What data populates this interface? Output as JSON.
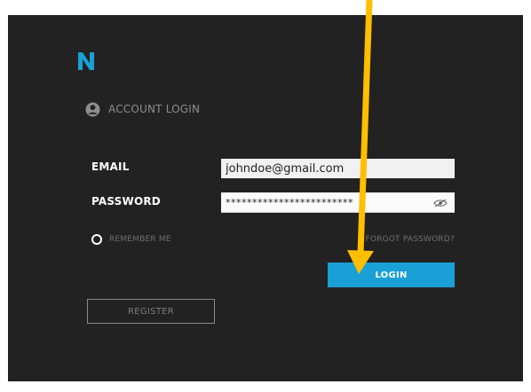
{
  "brand": {
    "logo_icon": "n-logo-icon",
    "accent_color": "#1aa0d7"
  },
  "header": {
    "icon": "user-icon",
    "title": "ACCOUNT LOGIN"
  },
  "form": {
    "email_label": "EMAIL",
    "email_value": "johndoe@gmail.com",
    "password_label": "PASSWORD",
    "password_value": "************************",
    "password_toggle_icon": "eye-icon",
    "remember_label": "REMEMBER ME",
    "forgot_label": "FORGOT PASSWORD?",
    "login_label": "LOGIN",
    "register_label": "REGISTER"
  },
  "annotation": {
    "color": "#ffbe00",
    "icon": "arrow-down-icon"
  }
}
